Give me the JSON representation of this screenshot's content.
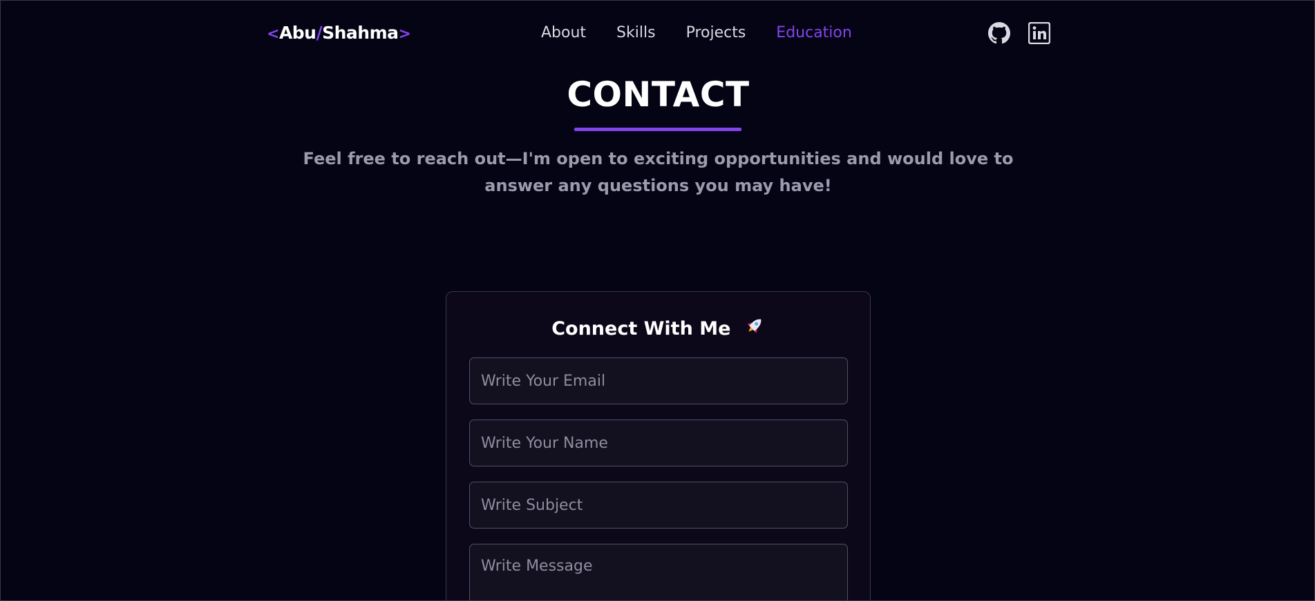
{
  "navbar": {
    "logo": {
      "open": "<",
      "first": "Abu",
      "slash": "/",
      "last": "Shahma",
      "close": ">"
    },
    "links": [
      {
        "label": "About",
        "active": false
      },
      {
        "label": "Skills",
        "active": false
      },
      {
        "label": "Projects",
        "active": false
      },
      {
        "label": "Education",
        "active": true
      }
    ],
    "social": [
      {
        "icon": "github-icon"
      },
      {
        "icon": "linkedin-icon"
      }
    ]
  },
  "contact": {
    "title": "CONTACT",
    "subtitle": "Feel free to reach out—I'm open to exciting opportunities and would love to answer any questions you may have!"
  },
  "form": {
    "title": "Connect With Me",
    "title_icon": "rocket-icon",
    "email_placeholder": "Write Your Email",
    "name_placeholder": "Write Your Name",
    "subject_placeholder": "Write Subject",
    "message_placeholder": "Write Message"
  },
  "colors": {
    "background": "#050414",
    "accent": "#8245ec",
    "subtitle": "#9d9aae",
    "card": "#0c0819",
    "field": "#13111f"
  }
}
